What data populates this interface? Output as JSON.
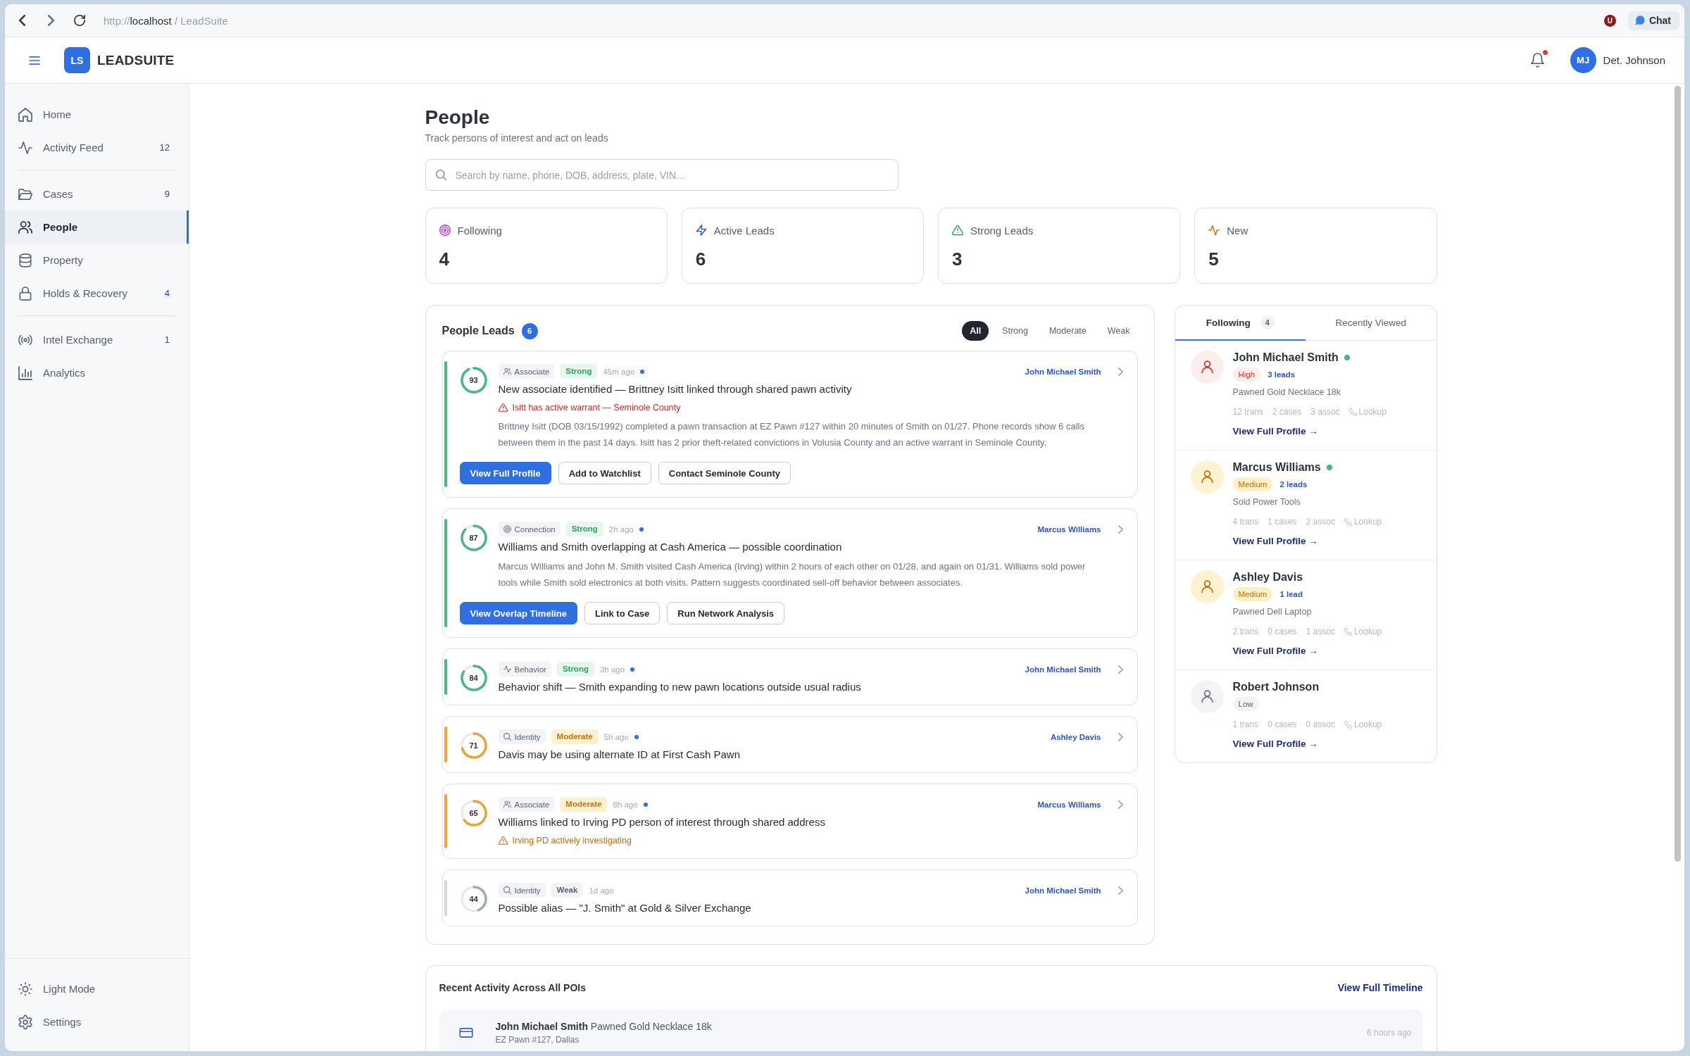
{
  "browser": {
    "address": {
      "scheme": "http://",
      "host": "localhost",
      "page": "/ LeadSuite"
    },
    "extension": "U",
    "chat": "Chat"
  },
  "header": {
    "logo": "LS",
    "brand": "LEADSUITE",
    "notifications": {
      "unread": true
    },
    "user": {
      "initials": "MJ",
      "name": "Det. Johnson"
    }
  },
  "sidebar": {
    "groups": [
      [
        {
          "label": "Home",
          "selected": false
        },
        {
          "label": "Activity Feed",
          "count": "12",
          "selected": false
        }
      ],
      [
        {
          "label": "Cases",
          "count": "9",
          "selected": false
        },
        {
          "label": "People",
          "selected": true
        },
        {
          "label": "Property",
          "selected": false
        },
        {
          "label": "Holds & Recovery",
          "count": "4",
          "selected": false
        }
      ],
      [
        {
          "label": "Intel Exchange",
          "count": "1",
          "selected": false
        },
        {
          "label": "Analytics",
          "selected": false
        }
      ]
    ],
    "footer": [
      {
        "label": "Light Mode"
      },
      {
        "label": "Settings"
      }
    ]
  },
  "page": {
    "title": "People",
    "subtitle": "Track persons of interest and act on leads",
    "search": {
      "placeholder": "Search by name, phone, DOB, address, plate, VIN..."
    }
  },
  "stats": [
    {
      "label": "Following",
      "value": "4"
    },
    {
      "label": "Active Leads",
      "value": "6"
    },
    {
      "label": "Strong Leads",
      "value": "3"
    },
    {
      "label": "New",
      "value": "5"
    }
  ],
  "leads": {
    "title": "People Leads",
    "count": "6",
    "filters": [
      {
        "label": "All",
        "selected": true
      },
      {
        "label": "Strong",
        "selected": false
      },
      {
        "label": "Moderate",
        "selected": false
      },
      {
        "label": "Weak",
        "selected": false
      }
    ],
    "items": [
      {
        "score": "93",
        "category": {
          "label": "Associate",
          "kind": "associate"
        },
        "strength": {
          "label": "Strong",
          "kind": "strong"
        },
        "time": "45m ago",
        "unread": true,
        "person": "John Michael Smith",
        "title": "New associate identified — Brittney Isitt linked through shared pawn activity",
        "warning": {
          "text": "Isitt has active warrant — Seminole County",
          "kind": "danger"
        },
        "description": "Brittney Isitt (DOB 03/15/1992) completed a pawn transaction at EZ Pawn #127 within 20 minutes of Smith on 01/27. Phone records show 6 calls between them in the past 14 days. Isitt has 2 prior theft-related convictions in Volusia County and an active warrant in Seminole County.",
        "actions": [
          {
            "label": "View Full Profile",
            "kind": "primary"
          },
          {
            "label": "Add to Watchlist",
            "kind": "secondary"
          },
          {
            "label": "Contact Seminole County",
            "kind": "secondary"
          }
        ]
      },
      {
        "score": "87",
        "category": {
          "label": "Connection",
          "kind": "connection"
        },
        "strength": {
          "label": "Strong",
          "kind": "strong"
        },
        "time": "2h ago",
        "unread": true,
        "person": "Marcus Williams",
        "title": "Williams and Smith overlapping at Cash America — possible coordination",
        "description": "Marcus Williams and John M. Smith visited Cash America (Irving) within 2 hours of each other on 01/28, and again on 01/31. Williams sold power tools while Smith sold electronics at both visits. Pattern suggests coordinated sell-off behavior between associates.",
        "actions": [
          {
            "label": "View Overlap Timeline",
            "kind": "primary"
          },
          {
            "label": "Link to Case",
            "kind": "secondary"
          },
          {
            "label": "Run Network Analysis",
            "kind": "secondary"
          }
        ]
      },
      {
        "score": "84",
        "category": {
          "label": "Behavior",
          "kind": "behavior"
        },
        "strength": {
          "label": "Strong",
          "kind": "strong"
        },
        "time": "3h ago",
        "unread": true,
        "person": "John Michael Smith",
        "title": "Behavior shift — Smith expanding to new pawn locations outside usual radius"
      },
      {
        "score": "71",
        "category": {
          "label": "Identity",
          "kind": "identity"
        },
        "strength": {
          "label": "Moderate",
          "kind": "moderate"
        },
        "time": "5h ago",
        "unread": true,
        "person": "Ashley Davis",
        "title": "Davis may be using alternate ID at First Cash Pawn"
      },
      {
        "score": "65",
        "category": {
          "label": "Associate",
          "kind": "associate"
        },
        "strength": {
          "label": "Moderate",
          "kind": "moderate"
        },
        "time": "8h ago",
        "unread": true,
        "person": "Marcus Williams",
        "title": "Williams linked to Irving PD person of interest through shared address",
        "warning": {
          "text": "Irving PD actively investigating",
          "kind": "caution"
        }
      },
      {
        "score": "44",
        "category": {
          "label": "Identity",
          "kind": "identity"
        },
        "strength": {
          "label": "Weak",
          "kind": "weak"
        },
        "time": "1d ago",
        "unread": false,
        "person": "John Michael Smith",
        "title": "Possible alias — \"J. Smith\" at Gold & Silver Exchange"
      }
    ]
  },
  "following_panel": {
    "tabs": [
      {
        "label": "Following",
        "count": "4",
        "selected": true
      },
      {
        "label": "Recently Viewed",
        "selected": false
      }
    ],
    "people": [
      {
        "name": "John Michael Smith",
        "online": true,
        "priority": {
          "label": "High",
          "kind": "high"
        },
        "leads": "3 leads",
        "activity": "Pawned Gold Necklace 18k",
        "stats": [
          "12 trans",
          "2 cases",
          "3 assoc"
        ],
        "lookup": "Lookup",
        "link": "View Full Profile →"
      },
      {
        "name": "Marcus Williams",
        "online": true,
        "priority": {
          "label": "Medium",
          "kind": "medium"
        },
        "leads": "2 leads",
        "activity": "Sold Power Tools",
        "stats": [
          "4 trans",
          "1 cases",
          "2 assoc"
        ],
        "lookup": "Lookup",
        "link": "View Full Profile →"
      },
      {
        "name": "Ashley Davis",
        "online": false,
        "priority": {
          "label": "Medium",
          "kind": "medium"
        },
        "leads": "1 lead",
        "activity": "Pawned Dell Laptop",
        "stats": [
          "2 trans",
          "0 cases",
          "1 assoc"
        ],
        "lookup": "Lookup",
        "link": "View Full Profile →"
      },
      {
        "name": "Robert Johnson",
        "online": false,
        "priority": {
          "label": "Low",
          "kind": "low"
        },
        "stats": [
          "1 trans",
          "0 cases",
          "0 assoc"
        ],
        "lookup": "Lookup",
        "link": "View Full Profile →"
      }
    ]
  },
  "recent_activity": {
    "title": "Recent Activity Across All POIs",
    "link": "View Full Timeline",
    "items": [
      {
        "text": "**John Michael Smith** Pawned Gold Necklace 18k",
        "location": "EZ Pawn #127, Dallas",
        "time": "6 hours ago"
      }
    ]
  }
}
